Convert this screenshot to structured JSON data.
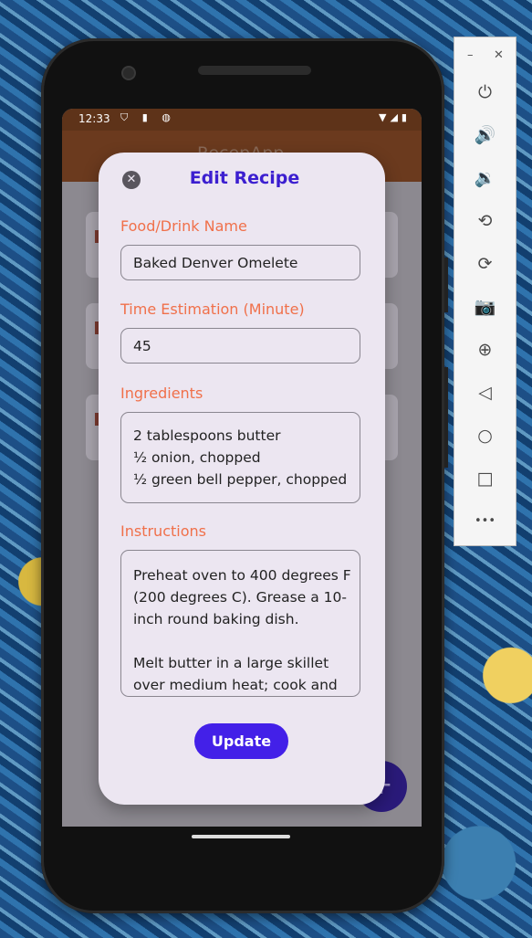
{
  "status_bar": {
    "time": "12:33",
    "left_icons": "⛉ ▮ ◍",
    "right_icons": "▼◢▮"
  },
  "app_bar": {
    "title": "RecepApp"
  },
  "background_fab": {
    "icon": "plus-icon",
    "symbol": "+"
  },
  "dialog": {
    "close_symbol": "✕",
    "title": "Edit Recipe",
    "fields": {
      "name": {
        "label": "Food/Drink Name",
        "value": "Baked Denver Omelete"
      },
      "time": {
        "label": "Time Estimation (Minute)",
        "value": "45"
      },
      "ingredients": {
        "label": "Ingredients",
        "value": "2 tablespoons butter\n½ onion, chopped\n½ green bell pepper, chopped"
      },
      "instructions": {
        "label": "Instructions",
        "value": "Preheat oven to 400 degrees F\n(200 degrees C). Grease a 10-\ninch round baking dish.\n\nMelt butter in a large skillet\nover medium heat; cook and"
      }
    },
    "update_label": "Update"
  },
  "emulator_panel": {
    "minimize": "–",
    "close": "✕",
    "buttons": [
      {
        "name": "power-icon",
        "glyph": "⏻"
      },
      {
        "name": "volume-up-icon",
        "glyph": "🔊"
      },
      {
        "name": "volume-down-icon",
        "glyph": "🔉"
      },
      {
        "name": "rotate-left-icon",
        "glyph": "⟲"
      },
      {
        "name": "rotate-right-icon",
        "glyph": "⟳"
      },
      {
        "name": "camera-icon",
        "glyph": "📷"
      },
      {
        "name": "zoom-icon",
        "glyph": "⊕"
      },
      {
        "name": "back-icon",
        "glyph": "◁"
      },
      {
        "name": "home-icon",
        "glyph": "○"
      },
      {
        "name": "overview-icon",
        "glyph": "□"
      },
      {
        "name": "more-icon",
        "glyph": "•••"
      }
    ]
  }
}
